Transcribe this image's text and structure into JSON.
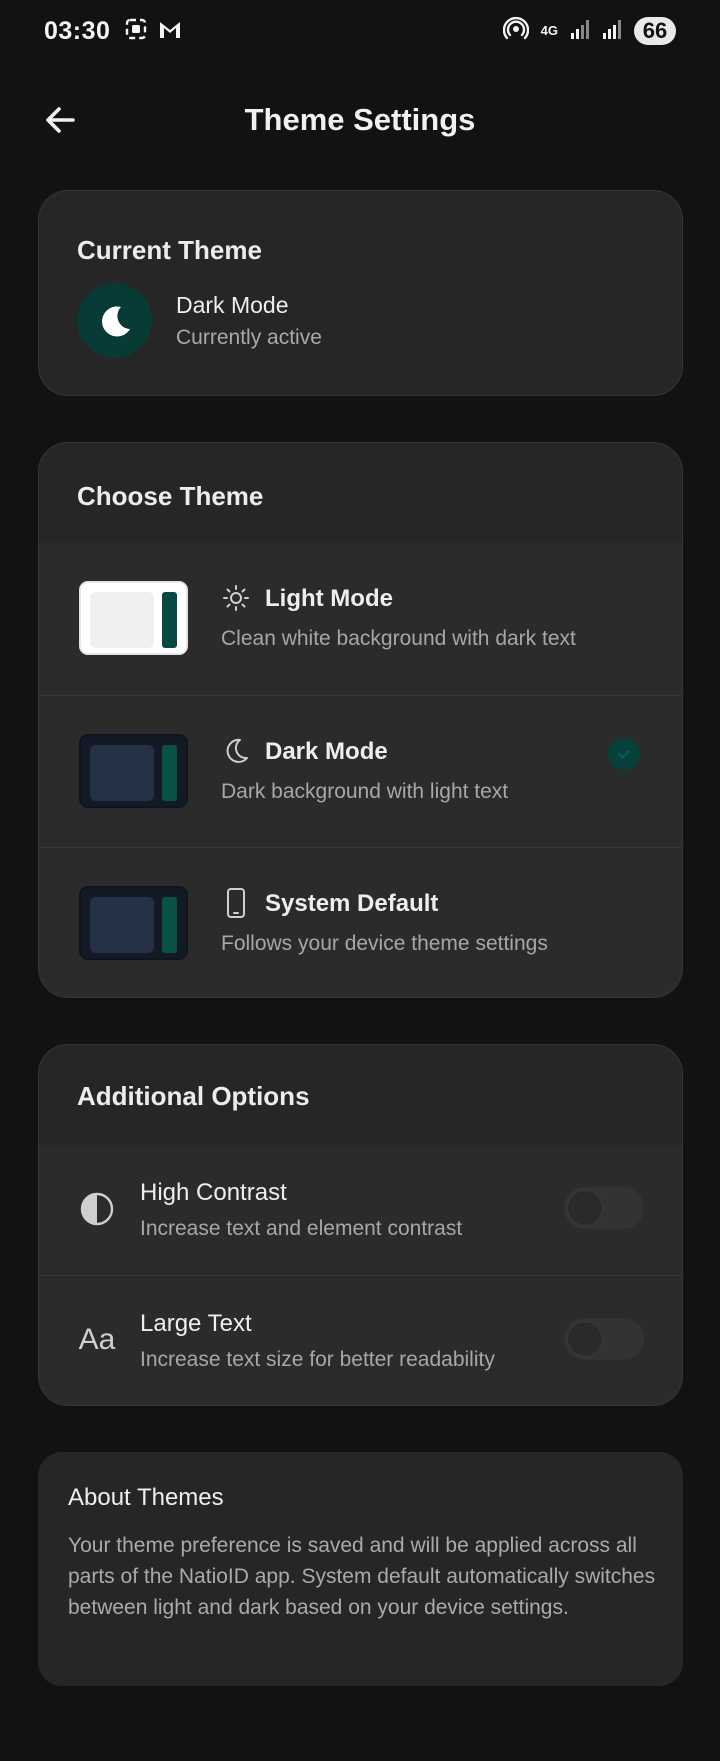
{
  "status_bar": {
    "time": "03:30",
    "network": "4G",
    "battery": "66"
  },
  "header": {
    "title": "Theme Settings"
  },
  "current_theme": {
    "heading": "Current Theme",
    "name": "Dark Mode",
    "status": "Currently active"
  },
  "choose_theme": {
    "heading": "Choose Theme",
    "options": [
      {
        "title": "Light Mode",
        "subtitle": "Clean white background with dark text",
        "icon": "sun-icon",
        "selected": false
      },
      {
        "title": "Dark Mode",
        "subtitle": "Dark background with light text",
        "icon": "moon-icon",
        "selected": true
      },
      {
        "title": "System Default",
        "subtitle": "Follows your device theme settings",
        "icon": "phone-icon",
        "selected": false
      }
    ]
  },
  "additional_options": {
    "heading": "Additional Options",
    "items": [
      {
        "title": "High Contrast",
        "subtitle": "Increase text and element contrast",
        "icon": "contrast-icon",
        "enabled": false
      },
      {
        "title": "Large Text",
        "subtitle": "Increase text size for better readability",
        "icon": "text-size-icon",
        "icon_text": "Aa",
        "enabled": false
      }
    ]
  },
  "about": {
    "heading": "About Themes",
    "body": "Your theme preference is saved and will be applied across all parts of the NatioID app. System default automatically switches between light and dark based on your device settings."
  },
  "colors": {
    "background": "#121212",
    "card": "#262626",
    "accent": "#083b36"
  }
}
